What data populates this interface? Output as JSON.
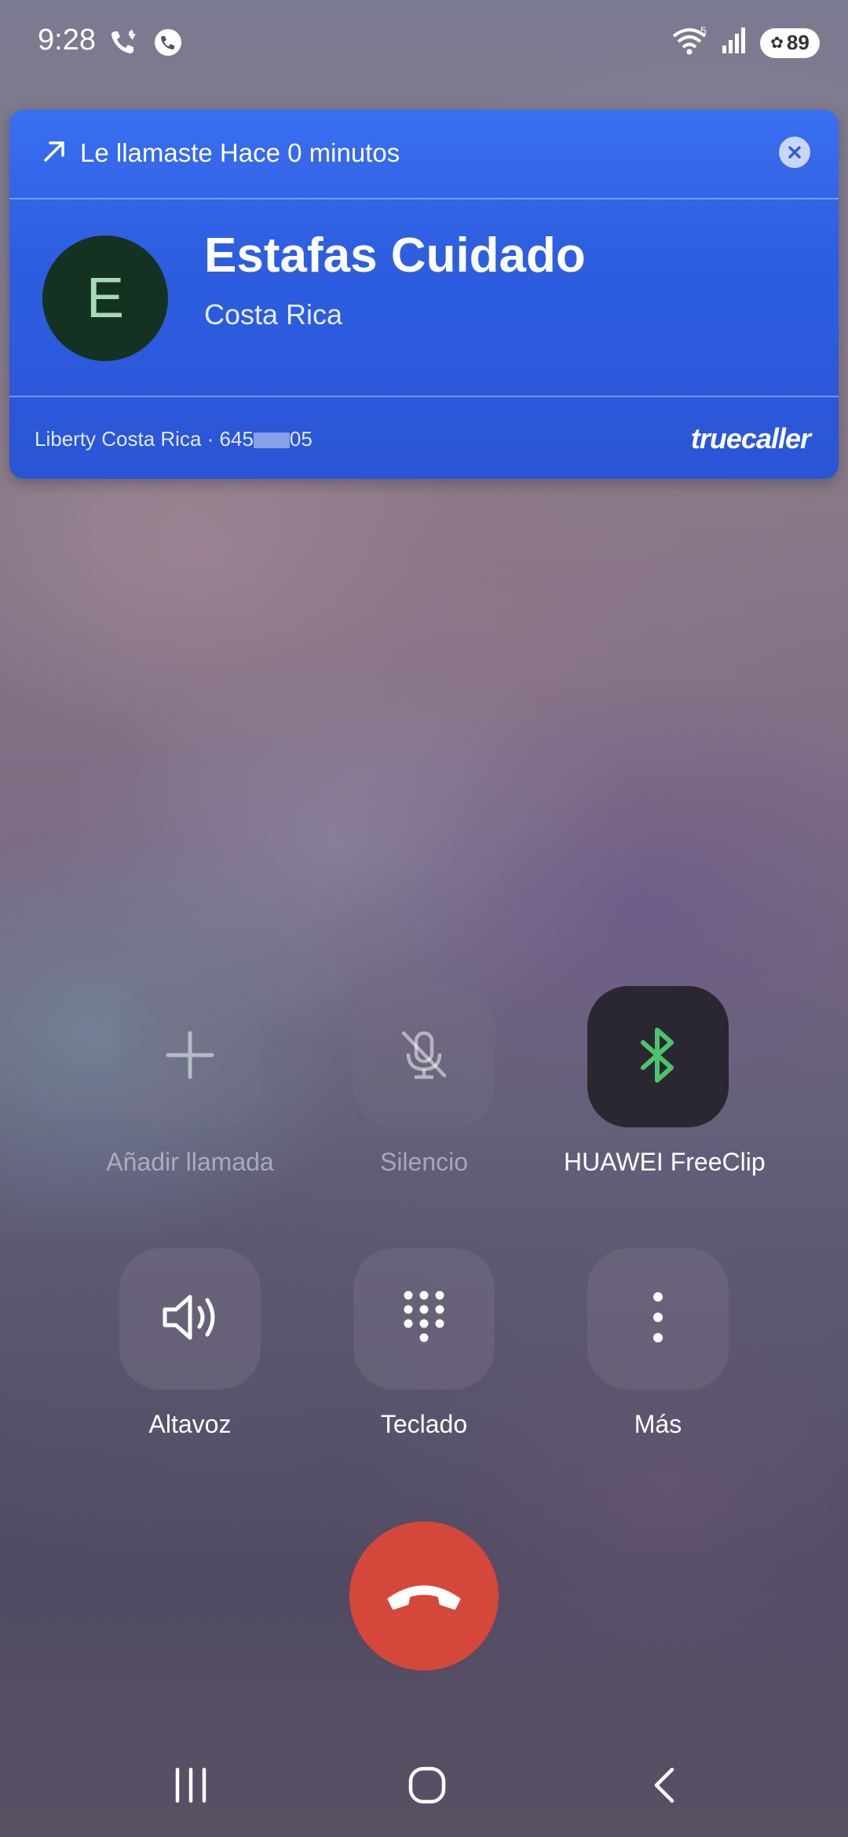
{
  "status_bar": {
    "time": "9:28",
    "signal_badge": "5",
    "battery": "89"
  },
  "caller_card": {
    "called_text": "Le llamaste Hace 0 minutos",
    "avatar_letter": "E",
    "caller_name": "Estafas Cuidado",
    "caller_region": "Costa Rica",
    "carrier_prefix": "Liberty Costa Rica · 645",
    "number_suffix": "05",
    "brand": "truecaller",
    "colors": {
      "card": "#2d5ee0",
      "avatar_bg": "#143221"
    }
  },
  "controls": [
    {
      "label": "Añadir llamada",
      "icon": "plus-icon",
      "enabled": false
    },
    {
      "label": "Silencio",
      "icon": "mic-off-icon",
      "enabled": false
    },
    {
      "label": "HUAWEI FreeClip",
      "icon": "bluetooth-icon",
      "enabled": true,
      "active": true
    },
    {
      "label": "Altavoz",
      "icon": "speaker-icon",
      "enabled": true
    },
    {
      "label": "Teclado",
      "icon": "keypad-icon",
      "enabled": true
    },
    {
      "label": "Más",
      "icon": "more-vertical-icon",
      "enabled": true
    }
  ],
  "end_call": {
    "icon": "hang-up-icon",
    "color": "#d5473a"
  },
  "nav_bar": {
    "items": [
      "recent-apps-icon",
      "home-icon",
      "back-icon"
    ]
  }
}
